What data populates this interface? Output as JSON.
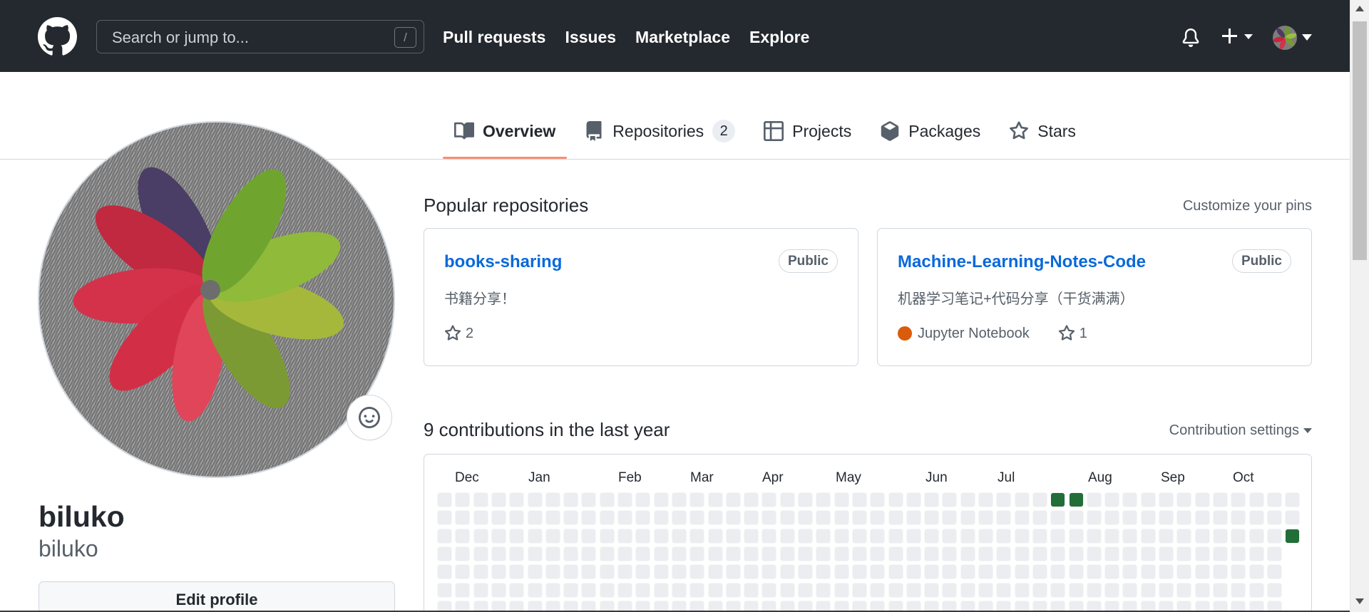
{
  "header": {
    "search_placeholder": "Search or jump to...",
    "search_shortcut": "/",
    "nav": [
      "Pull requests",
      "Issues",
      "Marketplace",
      "Explore"
    ]
  },
  "tabs": [
    {
      "label": "Overview",
      "icon": "book-icon",
      "selected": true
    },
    {
      "label": "Repositories",
      "icon": "repo-icon",
      "count": "2"
    },
    {
      "label": "Projects",
      "icon": "table-icon"
    },
    {
      "label": "Packages",
      "icon": "package-icon"
    },
    {
      "label": "Stars",
      "icon": "star-icon"
    }
  ],
  "profile": {
    "name": "biluko",
    "login": "biluko",
    "edit_label": "Edit profile"
  },
  "popular": {
    "title": "Popular repositories",
    "customize": "Customize your pins",
    "repos": [
      {
        "name": "books-sharing",
        "visibility": "Public",
        "description": "书籍分享！",
        "stars": "2"
      },
      {
        "name": "Machine-Learning-Notes-Code",
        "visibility": "Public",
        "description": "机器学习笔记+代码分享（干货满满）",
        "language": "Jupyter Notebook",
        "language_color": "#DA5B0B",
        "stars": "1"
      }
    ]
  },
  "contributions": {
    "title": "9 contributions in the last year",
    "settings": "Contribution settings",
    "months": [
      "Dec",
      "Jan",
      "Feb",
      "Mar",
      "Apr",
      "May",
      "Jun",
      "Jul",
      "Aug",
      "Sep",
      "Oct"
    ],
    "active_cells": [
      [
        34,
        0
      ],
      [
        35,
        0
      ],
      [
        47,
        2
      ]
    ]
  },
  "colors": {
    "header_bg": "#24292f",
    "link": "#0969da",
    "tab_underline": "#fd8c73",
    "contrib_level": "#216e39",
    "contrib_empty": "#ebedf0"
  }
}
